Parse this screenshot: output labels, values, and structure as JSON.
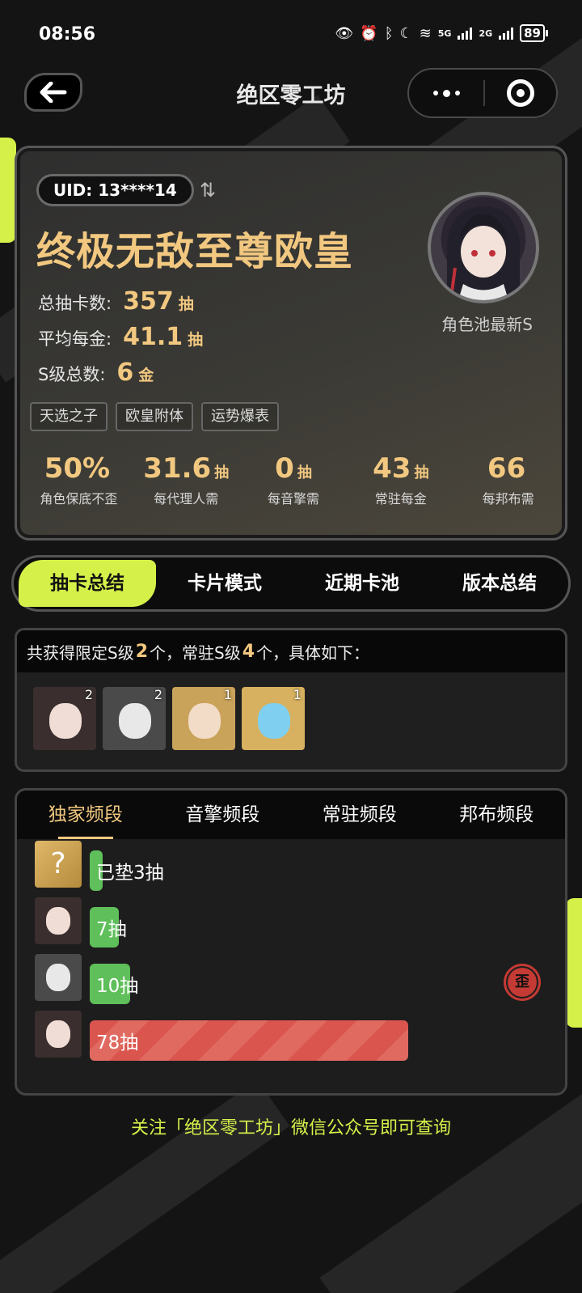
{
  "status_bar": {
    "time": "08:56",
    "signal1": "5G",
    "signal2": "2G",
    "battery": "89"
  },
  "header": {
    "title": "绝区零工坊"
  },
  "profile": {
    "uid": "UID: 13****14",
    "nickname": "终极无敌至尊欧皇",
    "stats": [
      {
        "label": "总抽卡数:",
        "value": "357",
        "unit": "抽"
      },
      {
        "label": "平均每金:",
        "value": "41.1",
        "unit": "抽"
      },
      {
        "label": "S级总数:",
        "value": "6",
        "unit": "金"
      }
    ],
    "avatar_caption": "角色池最新S",
    "tags": [
      "天选之子",
      "欧皇附体",
      "运势爆表"
    ],
    "metrics": [
      {
        "value": "50%",
        "unit": "",
        "label": "角色保底不歪"
      },
      {
        "value": "31.6",
        "unit": "抽",
        "label": "每代理人需"
      },
      {
        "value": "0",
        "unit": "抽",
        "label": "每音擎需"
      },
      {
        "value": "43",
        "unit": "抽",
        "label": "常驻每金"
      },
      {
        "value": "66",
        "unit": "",
        "label": "每邦布需"
      }
    ]
  },
  "main_tabs": [
    "抽卡总结",
    "卡片模式",
    "近期卡池",
    "版本总结"
  ],
  "s_summary": {
    "prefix": "共获得限定S级",
    "limited_count": "2",
    "middle": "个，常驻S级",
    "standard_count": "4",
    "suffix": "个，具体如下：",
    "characters": [
      {
        "count": "2",
        "bg": "#3a2f2e",
        "face": "#f0ddd5"
      },
      {
        "count": "2",
        "bg": "#4a4a4a",
        "face": "#e8e8e8"
      },
      {
        "count": "1",
        "bg": "#caa35a",
        "face": "#f2dcc8"
      },
      {
        "count": "1",
        "bg": "#d7b15f",
        "face": "#7fd0f0"
      }
    ]
  },
  "banner_tabs": [
    "独家频段",
    "音擎频段",
    "常驻频段",
    "邦布频段"
  ],
  "pulls": [
    {
      "label": "已垫3抽",
      "pulls": 3,
      "bar": "green",
      "thumb": "?"
    },
    {
      "label": "7抽",
      "pulls": 7,
      "bar": "green",
      "thumb": ""
    },
    {
      "label": "10抽",
      "pulls": 10,
      "bar": "green",
      "thumb": "",
      "lost_5050": true
    },
    {
      "label": "78抽",
      "pulls": 78,
      "bar": "red",
      "thumb": ""
    }
  ],
  "lost_badge": "歪",
  "footer_note": "关注「绝区零工坊」微信公众号即可查询"
}
